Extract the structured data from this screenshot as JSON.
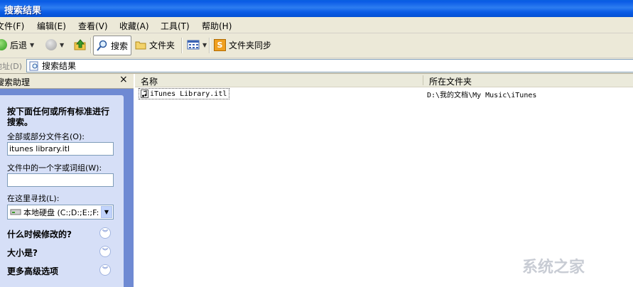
{
  "window": {
    "title": "搜索结果"
  },
  "menubar": {
    "items": [
      "文件(F)",
      "编辑(E)",
      "查看(V)",
      "收藏(A)",
      "工具(T)",
      "帮助(H)"
    ]
  },
  "toolbar": {
    "back_label": "后退",
    "search_label": "搜索",
    "folders_label": "文件夹",
    "sync_label": "文件夹同步"
  },
  "address": {
    "label": "地址(D)",
    "value": "搜索结果"
  },
  "search_pane": {
    "title": "搜索助理",
    "close": "×",
    "prompt": "按下面任何或所有标准进行搜索。",
    "filename_label": "全部或部分文件名(O):",
    "filename_value": "itunes library.itl",
    "word_label": "文件中的一个字或词组(W):",
    "word_value": "",
    "lookin_label": "在这里寻找(L):",
    "lookin_value": "本地硬盘 (C:;D:;E:;F:",
    "options": [
      "什么时候修改的?",
      "大小是?",
      "更多高级选项"
    ]
  },
  "results": {
    "columns": [
      "名称",
      "所在文件夹"
    ],
    "rows": [
      {
        "name": "iTunes Library.itl",
        "folder": "D:\\我的文档\\My Music\\iTunes"
      }
    ]
  },
  "watermark": "系统之家",
  "colors": {
    "titlebar": "#0b5ce6",
    "chrome": "#ece9d8",
    "taskpane": "#6f8ad3",
    "taskpanel": "#d6dff7"
  }
}
